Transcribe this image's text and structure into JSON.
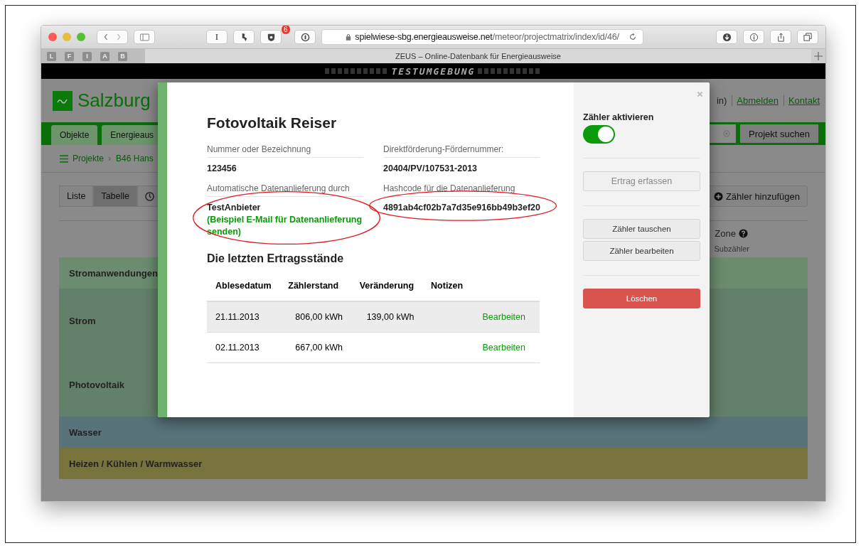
{
  "browser": {
    "text_button": "I",
    "badge": "6",
    "url_host": "spielwiese-sbg.energieausweise.net",
    "url_path": "/meteor/projectmatrix/index/id/46/",
    "pinned_tabs": [
      "L",
      "F",
      "I",
      "A",
      "B"
    ],
    "tab_title": "ZEUS – Online-Datenbank für Energieausweise"
  },
  "banner": {
    "text": "TESTUMGEBUNG"
  },
  "page": {
    "logo": "Salzburg",
    "login_fragment": "in)",
    "links": [
      "Abmelden",
      "Kontakt"
    ],
    "tabs": [
      "Objekte",
      "Energieaus"
    ],
    "search_button": "Projekt suchen",
    "breadcrumb": [
      "Projekte",
      "B46 Hans"
    ],
    "view_buttons": [
      {
        "label": "Liste",
        "selected": false
      },
      {
        "label": "Tabelle",
        "selected": true
      }
    ],
    "add_button": "Zähler hinzufügen",
    "zone_label": "Zone",
    "column_heading": "Subzähler",
    "categories": [
      {
        "name": "Stromanwendungen",
        "kind": "header",
        "color": "#6c8c70"
      },
      {
        "name": "Strom",
        "kind": "meter",
        "color": "#63806a"
      },
      {
        "name": "Photovoltaik",
        "kind": "meter",
        "color": "#63806a"
      },
      {
        "name": "Wasser",
        "kind": "header",
        "color": "#58737a"
      },
      {
        "name": "Heizen / Kühlen / Warmwasser",
        "kind": "header",
        "color": "#78733c"
      }
    ]
  },
  "modal": {
    "title": "Fotovoltaik Reiser",
    "fields": [
      {
        "label": "Nummer oder Bezeichnung",
        "value": "123456",
        "annotated": false
      },
      {
        "label": "Direktförderung-Fördernummer:",
        "value": "20404/PV/107531-2013",
        "annotated": false
      },
      {
        "label": "Automatische Datenanlieferung durch",
        "value": "TestAnbieter",
        "link": "(Beispiel E-Mail für Datenanlieferung senden)",
        "annotated": true
      },
      {
        "label": "Hashcode für die Datenanlieferung",
        "value": "4891ab4cf02b7a7d35e916bb49b3ef20",
        "annotated": true
      }
    ],
    "readings_heading": "Die letzten Ertragsstände",
    "table": {
      "columns": [
        "Ablesedatum",
        "Zählerstand",
        "Veränderung",
        "Notizen"
      ],
      "rows": [
        {
          "date": "21.11.2013",
          "reading": "806,00 kWh",
          "change": "139,00 kWh",
          "action": "Bearbeiten",
          "highlighted": true
        },
        {
          "date": "02.11.2013",
          "reading": "667,00 kWh",
          "action": "Bearbeiten",
          "highlighted": false
        }
      ]
    },
    "sidebar": {
      "toggle_label": "Zähler aktivieren",
      "toggle_on": true,
      "buttons": [
        {
          "label": "Ertrag erfassen",
          "kind": "default",
          "disabled": true,
          "separator_before": true
        },
        {
          "label": "Zähler tauschen",
          "kind": "default",
          "disabled": false,
          "separator_before": true
        },
        {
          "label": "Zähler bearbeiten",
          "kind": "default",
          "disabled": false,
          "separator_before": false
        },
        {
          "label": "Löschen",
          "kind": "danger",
          "disabled": false,
          "separator_before": true
        }
      ]
    }
  }
}
